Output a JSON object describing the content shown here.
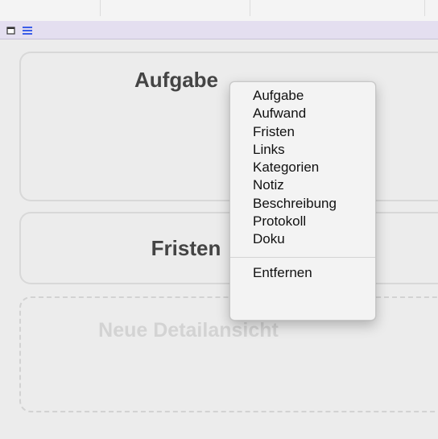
{
  "toolbar": {
    "icons": [
      "window-icon",
      "list-icon"
    ],
    "accent_color": "#3c5ee8",
    "background_color": "#e4dff0"
  },
  "panels": {
    "aufgabe_title": "Aufgabe",
    "fristen_title": "Fristen",
    "new_view_title": "Neue Detailansicht"
  },
  "context_menu": {
    "items": [
      "Aufgabe",
      "Aufwand",
      "Fristen",
      "Links",
      "Kategorien",
      "Notiz",
      "Beschreibung",
      "Protokoll",
      "Doku"
    ],
    "remove_label": "Entfernen"
  }
}
